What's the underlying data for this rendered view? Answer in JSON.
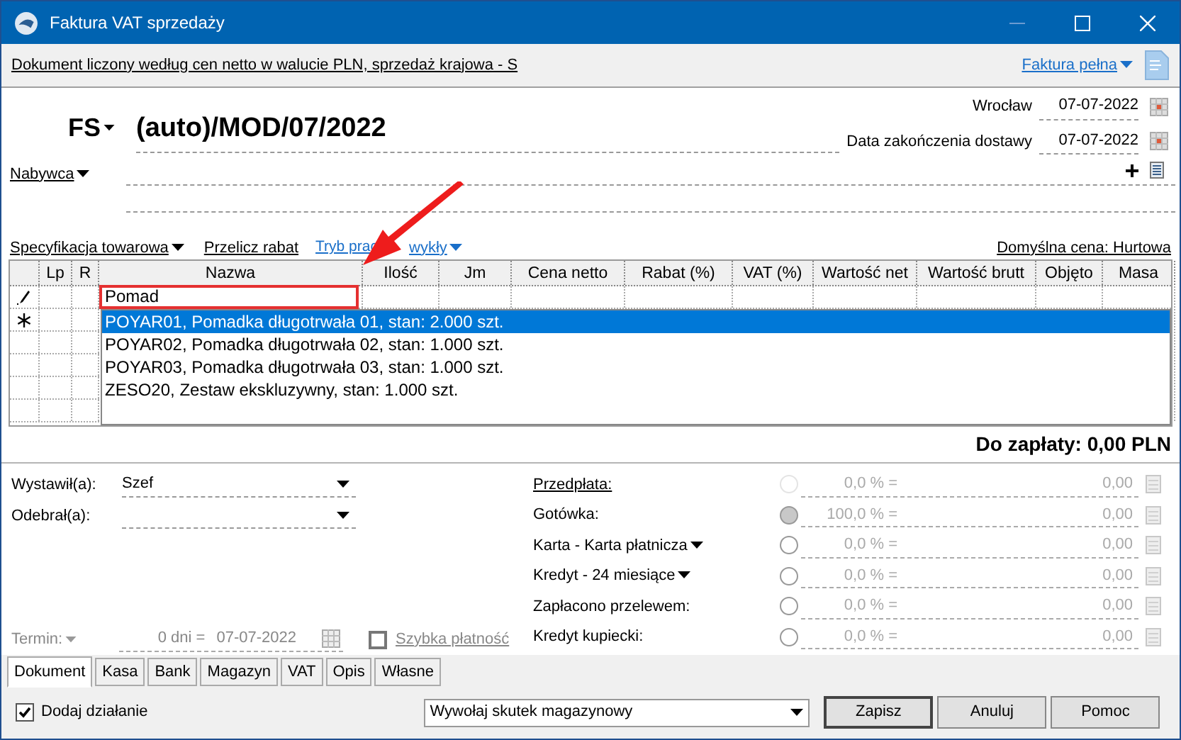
{
  "window": {
    "title": "Faktura VAT sprzedaży"
  },
  "info_bar": {
    "text": "Dokument liczony według cen netto w walucie PLN, sprzedaż krajowa - S",
    "invoice_type": "Faktura pełna"
  },
  "document": {
    "series": "FS",
    "number": "(auto)/MOD/07/2022",
    "place": "Wrocław",
    "issue_date": "07-07-2022",
    "delivery_date_label": "Data zakończenia dostawy",
    "delivery_date": "07-07-2022"
  },
  "buyer": {
    "label": "Nabywca"
  },
  "items_toolbar": {
    "specification": "Specyfikacja towarowa",
    "recalc": "Przelicz rabat",
    "mode_parts": [
      "Tryb prac",
      "wykły"
    ],
    "default_price": "Domyślna cena: Hurtowa"
  },
  "table": {
    "columns": [
      "Lp",
      "R",
      "Nazwa",
      "Ilość",
      "Jm",
      "Cena netto",
      "Rabat (%)",
      "VAT (%)",
      "Wartość net",
      "Wartość brutt",
      "Objęto",
      "Masa"
    ],
    "rows": [
      {
        "kind": "edit",
        "name_input": "Pomad"
      },
      {
        "kind": "new"
      }
    ]
  },
  "suggestions": [
    {
      "text": "POYAR01, Pomadka długotrwała 01, stan: 2.000 szt.",
      "selected": true
    },
    {
      "text": "POYAR02, Pomadka długotrwała 02, stan: 1.000 szt.",
      "selected": false
    },
    {
      "text": "POYAR03, Pomadka długotrwała 03, stan: 1.000 szt.",
      "selected": false
    },
    {
      "text": "ZESO20, Zestaw ekskluzywny, stan: 1.000 szt.",
      "selected": false
    }
  ],
  "total": "Do zapłaty: 0,00 PLN",
  "issued_by": {
    "label": "Wystawił(a):",
    "value": "Szef"
  },
  "received_by": {
    "label": "Odebrał(a):"
  },
  "term": {
    "label": "Termin:",
    "days": "0 dni =",
    "date": "07-07-2022"
  },
  "quick_payment": {
    "label": "Szybka płatność",
    "checked": false
  },
  "payments": [
    {
      "kind": "link",
      "label": "Przedpłata:",
      "selected": false,
      "disabled": true,
      "percent": "0,0 % =",
      "amount": "0,00"
    },
    {
      "kind": "plain",
      "label": "Gotówka:",
      "selected": true,
      "disabled": false,
      "percent": "100,0 % =",
      "amount": "0,00"
    },
    {
      "kind": "dropdown",
      "label": "Karta - Karta płatnicza",
      "selected": false,
      "disabled": false,
      "percent": "0,0 % =",
      "amount": "0,00"
    },
    {
      "kind": "dropdown",
      "label": "Kredyt - 24 miesiące",
      "selected": false,
      "disabled": false,
      "percent": "0,0 % =",
      "amount": "0,00"
    },
    {
      "kind": "plain",
      "label": "Zapłacono przelewem:",
      "selected": false,
      "disabled": false,
      "percent": "0,0 % =",
      "amount": "0,00"
    },
    {
      "kind": "plain",
      "label": "Kredyt kupiecki:",
      "selected": false,
      "disabled": false,
      "percent": "0,0 % =",
      "amount": "0,00"
    }
  ],
  "tabs": [
    {
      "label": "Dokument",
      "selected": true
    },
    {
      "label": "Kasa",
      "selected": false
    },
    {
      "label": "Bank",
      "selected": false
    },
    {
      "label": "Magazyn",
      "selected": false
    },
    {
      "label": "VAT",
      "selected": false
    },
    {
      "label": "Opis",
      "selected": false
    },
    {
      "label": "Własne",
      "selected": false
    }
  ],
  "add_action": {
    "label": "Dodaj działanie",
    "checked": true
  },
  "stock_action": "Wywołaj skutek magazynowy",
  "buttons": [
    "Zapisz",
    "Anuluj",
    "Pomoc"
  ]
}
